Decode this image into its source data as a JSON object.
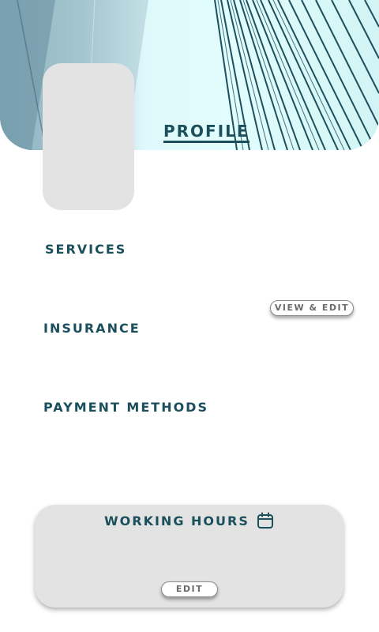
{
  "header": {
    "title": "PROFILE",
    "avatar_icon": "profile-photo-placeholder"
  },
  "sections": {
    "services": "SERVICES",
    "insurance": "INSURANCE",
    "payment_methods": "PAYMENT METHODS"
  },
  "actions": {
    "view_edit_label": "VIEW & EDIT"
  },
  "working_hours": {
    "title": "WORKING HOURS",
    "icon": "calendar-icon",
    "edit_label": "EDIT"
  },
  "colors": {
    "accent": "#1b4f5c",
    "card_bg": "#e3e3e3",
    "button_text": "#6b6b6b"
  }
}
